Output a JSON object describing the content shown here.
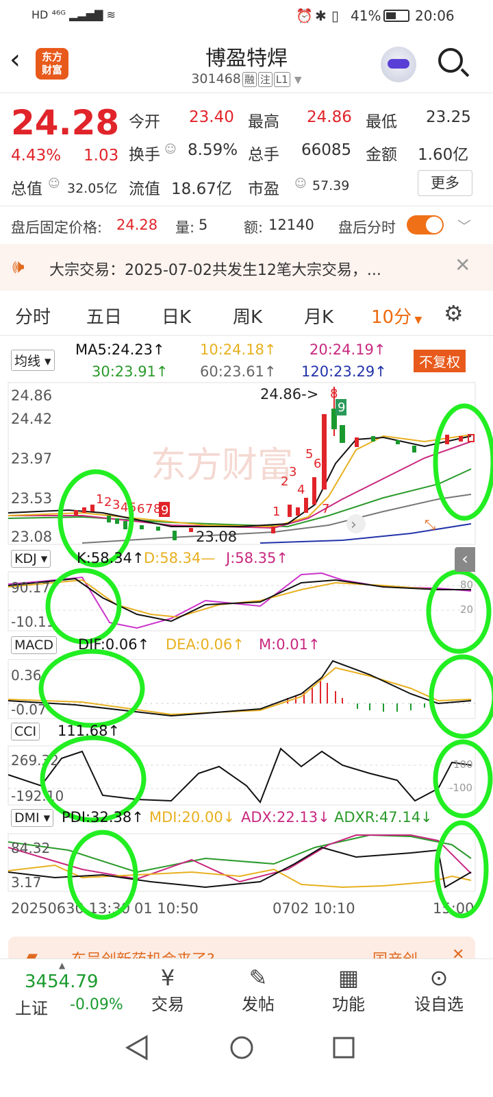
{
  "status_bar": {
    "left": "HD ⁴⁶ᴳ ▂▃▅▇ ≋",
    "battery": "41%",
    "time": "20:06"
  },
  "header": {
    "title": "博盈特焊",
    "code": "301468",
    "tags": [
      "融",
      "注",
      "L1"
    ],
    "logo_line1": "东方",
    "logo_line2": "财富"
  },
  "quote": {
    "price": "24.28",
    "change_pct": "4.43%",
    "change": "1.03",
    "open_label": "今开",
    "open": "23.40",
    "high_label": "最高",
    "high": "24.86",
    "low_label": "最低",
    "low": "23.25",
    "turnover_label": "换手",
    "turnover": "8.59%",
    "volume_label": "总手",
    "volume": "66085",
    "amount_label": "金额",
    "amount": "1.60亿",
    "mktcap_label": "总值",
    "mktcap": "32.05亿",
    "float_label": "流值",
    "float_cap": "18.67亿",
    "pe_label": "市盈",
    "pe": "57.39",
    "more_label": "更多"
  },
  "after_hours": {
    "price_label": "盘后固定价格:",
    "price": "24.28",
    "qty_label": "量:",
    "qty": "5",
    "amt_label": "额:",
    "amt": "12140",
    "toggle_label": "盘后分时"
  },
  "notice": {
    "text": "大宗交易：2025-07-02共发生12笔大宗交易，..."
  },
  "tabs": [
    "分时",
    "五日",
    "日K",
    "周K",
    "月K",
    "10分"
  ],
  "ma_legend": {
    "selector": "均线",
    "ma5": "MA5:24.23↑",
    "ma10": "10:24.18↑",
    "ma20": "20:24.19↑",
    "ma30": "30:23.91↑",
    "ma60": "60:23.61↑",
    "ma120": "120:23.29↑",
    "adjust": "不复权"
  },
  "kline_axis": [
    "24.86",
    "24.42",
    "23.97",
    "23.53",
    "23.08"
  ],
  "kline_marks": {
    "high_note": "24.86->",
    "low_note": "23.08",
    "watermark": "东方财富"
  },
  "kdj": {
    "name": "KDJ",
    "k": "K:58.34↑",
    "d": "D:58.34—",
    "j": "J:58.35↑",
    "axis_top": "90.17",
    "axis_bottom": "-10.11",
    "right_top": "80",
    "right_bottom": "20"
  },
  "macd": {
    "name": "MACD",
    "dif": "DIF:0.06↑",
    "dea": "DEA:0.06↑",
    "m": "M:0.01↑",
    "axis_top": "0.36",
    "axis_bottom": "-0.07"
  },
  "cci": {
    "name": "CCI",
    "value": "111.68↑",
    "axis_top": "269.32",
    "axis_bottom": "-192.10",
    "right_top": "100",
    "right_bottom": "-100"
  },
  "dmi": {
    "name": "DMI",
    "pdi": "PDI:32.38↑",
    "mdi": "MDI:20.00↓",
    "adx": "ADX:22.13↓",
    "adxr": "ADXR:47.14↓",
    "axis_top": "84.32",
    "axis_bottom": "3.17"
  },
  "time_axis": [
    "20250630 13:30",
    "01 10:50",
    "0702 10:10",
    "15:00"
  ],
  "ad_banner": {
    "text": "东吴创新药机会来了?",
    "right": "国产创"
  },
  "bottom_nav": {
    "index_value": "3454.79",
    "index_name": "上证",
    "index_change": "-0.09%",
    "items": [
      {
        "label": "交易",
        "icon": "¥"
      },
      {
        "label": "发帖",
        "icon": "✎"
      },
      {
        "label": "功能",
        "icon": "▦"
      },
      {
        "label": "设自选",
        "icon": "⊙"
      }
    ]
  },
  "colors": {
    "up": "#e0242a",
    "down": "#1a9a2e",
    "accent": "#ee6a10",
    "ma5": "#111111",
    "ma10": "#e8b020",
    "ma20": "#c8287f",
    "ma30": "#2a9a2a",
    "ma60": "#777777",
    "ma120": "#2233aa"
  }
}
